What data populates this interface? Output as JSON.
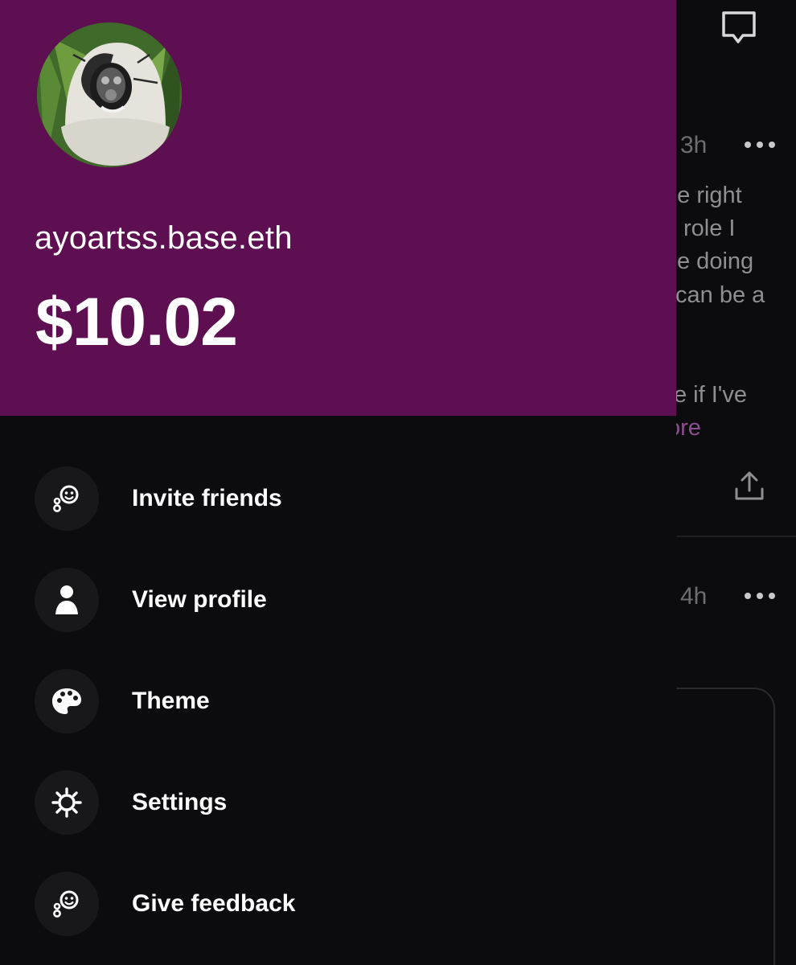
{
  "feed": {
    "post1": {
      "time": "3h",
      "lines": [
        "ne right",
        "role I",
        "e doing",
        "can be a",
        "e if I've"
      ],
      "see_more": "ore"
    },
    "post2": {
      "time": "4h"
    }
  },
  "drawer": {
    "username": "ayoartss.base.eth",
    "balance": "$10.02",
    "header_color": "#5e0f52",
    "menu": [
      {
        "label": "Invite friends",
        "icon": "invite-friends-icon"
      },
      {
        "label": "View profile",
        "icon": "person-icon"
      },
      {
        "label": "Theme",
        "icon": "palette-icon"
      },
      {
        "label": "Settings",
        "icon": "gear-icon"
      },
      {
        "label": "Give feedback",
        "icon": "feedback-icon"
      }
    ]
  }
}
